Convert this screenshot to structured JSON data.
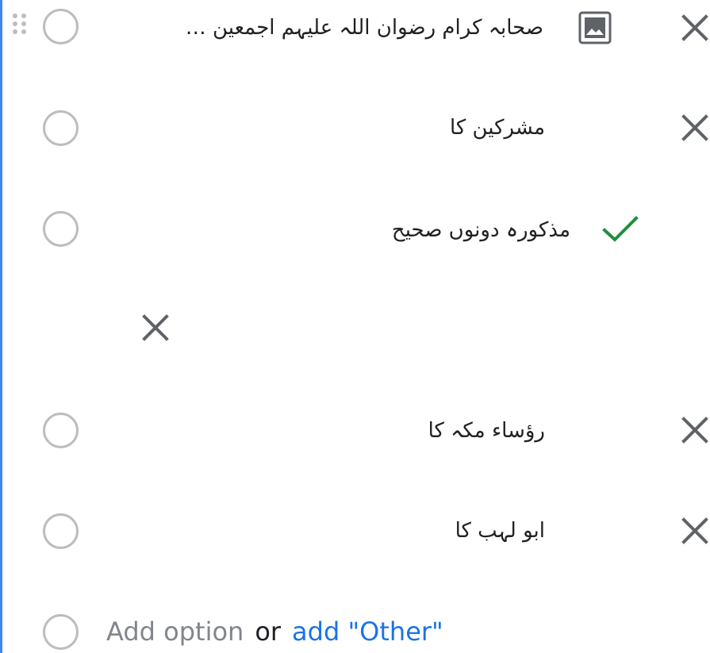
{
  "colors": {
    "focus_bar": "#4285f4",
    "radio_border": "#bdbdbd",
    "correct_check": "#1e8e3e",
    "link": "#1a73e8",
    "muted": "#80868b"
  },
  "options": [
    {
      "label": "صحابہ کرام رضوان اللہ علیہم اجمعین …",
      "has_image_button": true,
      "removable": true
    },
    {
      "label": "مشرکین کا",
      "removable": true
    },
    {
      "label": "مذکورہ دونوں صحیح",
      "correct": true,
      "removable": false
    },
    {
      "label": "رؤساء مکہ کا",
      "removable": true
    },
    {
      "label": "ابو لہب کا",
      "removable": true
    }
  ],
  "add_row": {
    "add_option": "Add option",
    "or": "or",
    "add_other": "add \"Other\""
  },
  "icons": {
    "drag": "drag-handle-icon",
    "image": "image-icon",
    "remove": "close-icon",
    "correct": "checkmark-icon"
  }
}
